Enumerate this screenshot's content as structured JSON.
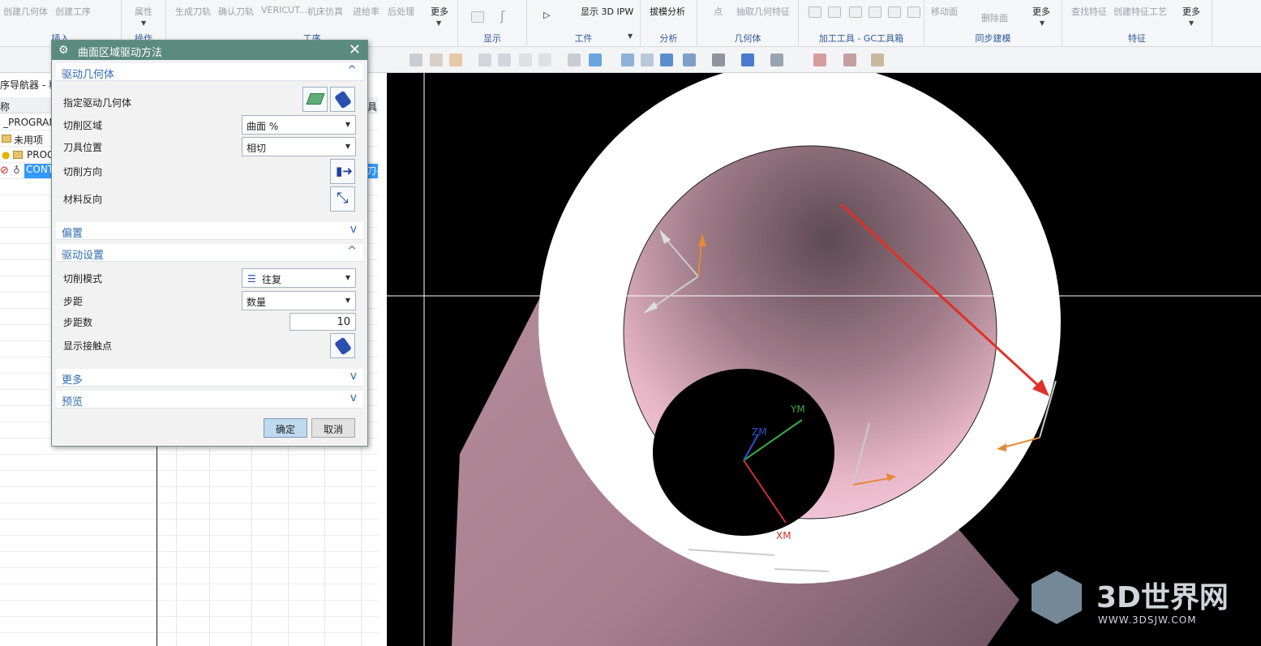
{
  "ribbon": {
    "insert_items": [
      "创建几何体",
      "创建工序"
    ],
    "insert_group": "插入",
    "ops_item": "属性",
    "ops_group": "操作",
    "proc_items": [
      "生成刀轨",
      "确认刀轨",
      "VERICUT...",
      "机床仿真",
      "进给率",
      "后处理"
    ],
    "proc_more": "更多",
    "proc_group": "工序",
    "display_group": "显示",
    "workpiece_item": "显示 3D IPW",
    "workpiece_group": "工件",
    "analysis_item": "拔模分析",
    "analysis_group": "分析",
    "geom_items": [
      "点",
      "抽取几何特征"
    ],
    "geom_group": "几何体",
    "tools_group": "加工工具 - GC工具箱",
    "sync_items": [
      "移动面",
      "删除面"
    ],
    "sync_more": "更多",
    "sync_group": "同步建模",
    "feature_items": [
      "查找特征",
      "创建特征工艺"
    ],
    "feature_more": "更多",
    "feature_group": "特征"
  },
  "navigator": {
    "title": "序导航器 - 程",
    "col_name": "称",
    "col_right": "具",
    "rows": [
      "_PROGRAM",
      "未用项",
      "PROG",
      "CONT"
    ],
    "sel_tail": "刀-"
  },
  "dialog": {
    "title": "曲面区域驱动方法",
    "sec_geometry": "驱动几何体",
    "specify_drive": "指定驱动几何体",
    "cut_area_label": "切削区域",
    "cut_area_value": "曲面 %",
    "tool_pos_label": "刀具位置",
    "tool_pos_value": "相切",
    "cut_dir_label": "切削方向",
    "material_rev_label": "材料反向",
    "sec_offset": "偏置",
    "sec_drive_settings": "驱动设置",
    "cut_pattern_label": "切削模式",
    "cut_pattern_value": "往复",
    "stepover_label": "步距",
    "stepover_value": "数量",
    "stepcount_label": "步距数",
    "stepcount_value": "10",
    "show_contact_label": "显示接触点",
    "sec_more": "更多",
    "sec_preview": "预览",
    "ok": "确定",
    "cancel": "取消"
  },
  "viewport": {
    "axis_x": "XM",
    "axis_y": "YM",
    "axis_z": "ZM"
  },
  "watermark": {
    "brand": "3D世界网",
    "url": "WWW.3DSJW.COM"
  },
  "colors": {
    "dialog_header": "#5b8b7f",
    "section_text": "#2f6cb3",
    "part_pink": "#c59aa8",
    "arrow_red": "#e0302a",
    "ok_button": "#bfd9ee"
  }
}
